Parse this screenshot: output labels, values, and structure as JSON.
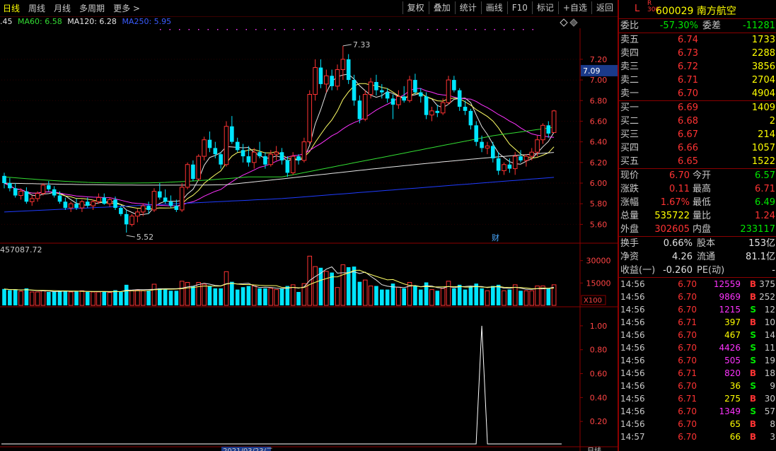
{
  "toolbar": {
    "periods": [
      "日线",
      "周线",
      "月线",
      "多周期",
      "更多 >"
    ],
    "actions": [
      "复权",
      "叠加",
      "统计",
      "画线",
      "F10",
      "标记",
      "+自选",
      "返回"
    ]
  },
  "legend": {
    "ma_partial": ".45",
    "ma60": "MA60: 6.58",
    "ma120": "MA120: 6.28",
    "ma250": "MA250: 5.95"
  },
  "price_axis": [
    "7.20",
    "7.00",
    "6.80",
    "6.60",
    "6.40",
    "6.20",
    "6.00",
    "5.80",
    "5.60"
  ],
  "price_tag": "7.09",
  "hi_label": "7.33",
  "lo_label": "5.52",
  "cai_label": "财",
  "vol_axis": [
    "30000",
    "15000"
  ],
  "vol_scale": "X100",
  "vol_value": "457087.72",
  "ind_axis": [
    "1.00",
    "0.80",
    "0.60",
    "0.40",
    "0.20"
  ],
  "bottom_date": "2021/03/23/二",
  "bottom_period": "日线",
  "colors": {
    "up": "#ff3333",
    "down": "#00e5ff",
    "ma_white": "#e6e6e6",
    "ma_yellow": "#ffff66",
    "ma_magenta": "#ff33ff",
    "ma_green": "#33dd33",
    "ma_blue": "#1f3cff"
  },
  "chart_data": {
    "type": "candlestick",
    "y_range": [
      5.5,
      7.35
    ],
    "candles": [
      [
        6.07,
        6.1,
        5.95,
        6.0
      ],
      [
        6.0,
        6.05,
        5.92,
        5.95
      ],
      [
        5.95,
        6.0,
        5.86,
        5.88
      ],
      [
        5.88,
        5.95,
        5.84,
        5.92
      ],
      [
        5.92,
        5.96,
        5.8,
        5.82
      ],
      [
        5.82,
        5.88,
        5.78,
        5.85
      ],
      [
        5.85,
        5.92,
        5.82,
        5.9
      ],
      [
        5.9,
        6.0,
        5.88,
        5.98
      ],
      [
        5.98,
        6.02,
        5.92,
        5.94
      ],
      [
        5.94,
        5.97,
        5.86,
        5.88
      ],
      [
        5.88,
        5.92,
        5.8,
        5.82
      ],
      [
        5.82,
        5.86,
        5.74,
        5.76
      ],
      [
        5.76,
        5.82,
        5.72,
        5.8
      ],
      [
        5.8,
        5.85,
        5.74,
        5.76
      ],
      [
        5.76,
        5.84,
        5.72,
        5.82
      ],
      [
        5.82,
        5.86,
        5.76,
        5.78
      ],
      [
        5.78,
        5.84,
        5.74,
        5.82
      ],
      [
        5.82,
        5.9,
        5.8,
        5.86
      ],
      [
        5.86,
        5.9,
        5.79,
        5.8
      ],
      [
        5.8,
        5.86,
        5.77,
        5.84
      ],
      [
        5.84,
        5.87,
        5.74,
        5.76
      ],
      [
        5.76,
        5.78,
        5.68,
        5.7
      ],
      [
        5.7,
        5.74,
        5.52,
        5.6
      ],
      [
        5.6,
        5.7,
        5.58,
        5.68
      ],
      [
        5.68,
        5.75,
        5.62,
        5.72
      ],
      [
        5.72,
        5.8,
        5.68,
        5.78
      ],
      [
        5.78,
        5.82,
        5.7,
        5.74
      ],
      [
        5.74,
        5.95,
        5.72,
        5.92
      ],
      [
        5.92,
        6.0,
        5.84,
        5.86
      ],
      [
        5.86,
        5.94,
        5.8,
        5.82
      ],
      [
        5.82,
        5.88,
        5.76,
        5.78
      ],
      [
        5.78,
        5.84,
        5.72,
        5.74
      ],
      [
        5.74,
        6.0,
        5.72,
        5.96
      ],
      [
        5.96,
        6.2,
        5.94,
        6.18
      ],
      [
        6.18,
        6.22,
        6.02,
        6.04
      ],
      [
        6.04,
        6.28,
        6.02,
        6.26
      ],
      [
        6.26,
        6.45,
        6.22,
        6.42
      ],
      [
        6.42,
        6.5,
        6.3,
        6.34
      ],
      [
        6.34,
        6.4,
        6.24,
        6.28
      ],
      [
        6.28,
        6.3,
        6.14,
        6.18
      ],
      [
        6.18,
        6.6,
        6.16,
        6.55
      ],
      [
        6.55,
        6.65,
        6.38,
        6.4
      ],
      [
        6.4,
        6.44,
        6.3,
        6.32
      ],
      [
        6.32,
        6.38,
        6.2,
        6.26
      ],
      [
        6.26,
        6.36,
        6.16,
        6.2
      ],
      [
        6.2,
        6.34,
        6.14,
        6.3
      ],
      [
        6.3,
        6.4,
        6.24,
        6.26
      ],
      [
        6.26,
        6.3,
        6.14,
        6.18
      ],
      [
        6.18,
        6.32,
        6.16,
        6.28
      ],
      [
        6.28,
        6.36,
        6.22,
        6.3
      ],
      [
        6.3,
        6.34,
        6.18,
        6.22
      ],
      [
        6.22,
        6.26,
        6.06,
        6.1
      ],
      [
        6.1,
        6.3,
        6.08,
        6.26
      ],
      [
        6.26,
        6.28,
        6.18,
        6.22
      ],
      [
        6.22,
        6.44,
        6.2,
        6.4
      ],
      [
        6.4,
        6.9,
        6.38,
        6.86
      ],
      [
        6.86,
        7.2,
        6.8,
        7.12
      ],
      [
        7.12,
        7.2,
        6.92,
        6.96
      ],
      [
        6.96,
        7.1,
        6.88,
        7.04
      ],
      [
        7.04,
        7.1,
        6.9,
        6.94
      ],
      [
        6.94,
        7.15,
        6.9,
        7.1
      ],
      [
        7.1,
        7.33,
        7.0,
        7.2
      ],
      [
        7.2,
        7.25,
        6.96,
        7.0
      ],
      [
        7.0,
        7.05,
        6.75,
        6.8
      ],
      [
        6.8,
        6.85,
        6.58,
        6.62
      ],
      [
        6.62,
        6.9,
        6.6,
        6.86
      ],
      [
        6.86,
        7.02,
        6.82,
        6.98
      ],
      [
        6.98,
        7.05,
        6.85,
        6.9
      ],
      [
        6.9,
        6.96,
        6.82,
        6.88
      ],
      [
        6.88,
        6.92,
        6.78,
        6.82
      ],
      [
        6.82,
        6.86,
        6.62,
        6.76
      ],
      [
        6.76,
        6.9,
        6.72,
        6.84
      ],
      [
        6.84,
        6.94,
        6.78,
        6.8
      ],
      [
        6.8,
        7.04,
        6.78,
        7.0
      ],
      [
        7.0,
        7.06,
        6.86,
        6.88
      ],
      [
        6.88,
        6.92,
        6.78,
        6.84
      ],
      [
        6.84,
        6.88,
        6.62,
        6.66
      ],
      [
        6.66,
        6.74,
        6.6,
        6.7
      ],
      [
        6.7,
        6.76,
        6.64,
        6.68
      ],
      [
        6.68,
        6.82,
        6.66,
        6.78
      ],
      [
        6.78,
        7.04,
        6.76,
        7.0
      ],
      [
        7.0,
        7.04,
        6.88,
        6.9
      ],
      [
        6.9,
        6.92,
        6.7,
        6.74
      ],
      [
        6.74,
        6.8,
        6.66,
        6.7
      ],
      [
        6.7,
        6.72,
        6.52,
        6.56
      ],
      [
        6.56,
        6.6,
        6.36,
        6.4
      ],
      [
        6.4,
        6.46,
        6.3,
        6.34
      ],
      [
        6.34,
        6.4,
        6.28,
        6.36
      ],
      [
        6.36,
        6.4,
        6.2,
        6.24
      ],
      [
        6.24,
        6.3,
        6.08,
        6.12
      ],
      [
        6.12,
        6.2,
        6.08,
        6.18
      ],
      [
        6.18,
        6.24,
        6.1,
        6.14
      ],
      [
        6.14,
        6.3,
        6.08,
        6.26
      ],
      [
        6.26,
        6.32,
        6.2,
        6.22
      ],
      [
        6.22,
        6.28,
        6.16,
        6.26
      ],
      [
        6.26,
        6.34,
        6.22,
        6.3
      ],
      [
        6.3,
        6.46,
        6.26,
        6.42
      ],
      [
        6.42,
        6.58,
        6.38,
        6.56
      ],
      [
        6.56,
        6.6,
        6.44,
        6.48
      ],
      [
        6.49,
        6.71,
        6.49,
        6.7
      ]
    ],
    "volume_max": 36000,
    "indicator": {
      "y_range": [
        0,
        1.1
      ],
      "spike_index": 86,
      "spike_value": 1.0
    }
  },
  "quote": {
    "L": "L",
    "R": "R",
    "idx": "300",
    "code_name": "600029 南方航空",
    "weibi_label": "委比",
    "weibi": "-57.30%",
    "weicha_label": "委差",
    "weicha": "-11281",
    "sells": [
      {
        "label": "卖五",
        "price": "6.74",
        "vol": "1733"
      },
      {
        "label": "卖四",
        "price": "6.73",
        "vol": "2288"
      },
      {
        "label": "卖三",
        "price": "6.72",
        "vol": "3856"
      },
      {
        "label": "卖二",
        "price": "6.71",
        "vol": "2704"
      },
      {
        "label": "卖一",
        "price": "6.70",
        "vol": "4904"
      }
    ],
    "buys": [
      {
        "label": "买一",
        "price": "6.69",
        "vol": "1409"
      },
      {
        "label": "买二",
        "price": "6.68",
        "vol": "2"
      },
      {
        "label": "买三",
        "price": "6.67",
        "vol": "214"
      },
      {
        "label": "买四",
        "price": "6.66",
        "vol": "1057"
      },
      {
        "label": "买五",
        "price": "6.65",
        "vol": "1522"
      }
    ],
    "stats": [
      {
        "l1": "现价",
        "v1": "6.70",
        "l2": "今开",
        "v2": "6.57"
      },
      {
        "l1": "涨跌",
        "v1": "0.11",
        "l2": "最高",
        "v2": "6.71"
      },
      {
        "l1": "涨幅",
        "v1": "1.67%",
        "l2": "最低",
        "v2": "6.49"
      },
      {
        "l1": "总量",
        "v1": "535722",
        "l2": "量比",
        "v2": "1.24"
      },
      {
        "l1": "外盘",
        "v1": "302605",
        "l2": "内盘",
        "v2": "233117"
      }
    ],
    "info": [
      {
        "l1": "换手",
        "v1": "0.66%",
        "l2": "股本",
        "v2": "153亿"
      },
      {
        "l1": "净资",
        "v1": "4.26",
        "l2": "流通",
        "v2": "81.1亿"
      },
      {
        "l1": "收益(一)",
        "v1": "-0.260",
        "l2": "PE(动)",
        "v2": "-"
      }
    ],
    "ticks": [
      {
        "t": "14:56",
        "p": "6.70",
        "q": "12559",
        "bs": "B",
        "n": "375"
      },
      {
        "t": "14:56",
        "p": "6.70",
        "q": "9869",
        "bs": "B",
        "n": "252"
      },
      {
        "t": "14:56",
        "p": "6.70",
        "q": "1215",
        "bs": "S",
        "n": "12"
      },
      {
        "t": "14:56",
        "p": "6.71",
        "q": "397",
        "bs": "B",
        "n": "10"
      },
      {
        "t": "14:56",
        "p": "6.70",
        "q": "467",
        "bs": "S",
        "n": "14"
      },
      {
        "t": "14:56",
        "p": "6.70",
        "q": "4426",
        "bs": "S",
        "n": "11"
      },
      {
        "t": "14:56",
        "p": "6.70",
        "q": "505",
        "bs": "S",
        "n": "19"
      },
      {
        "t": "14:56",
        "p": "6.71",
        "q": "820",
        "bs": "B",
        "n": "18"
      },
      {
        "t": "14:56",
        "p": "6.70",
        "q": "36",
        "bs": "S",
        "n": "9"
      },
      {
        "t": "14:56",
        "p": "6.71",
        "q": "275",
        "bs": "B",
        "n": "30"
      },
      {
        "t": "14:56",
        "p": "6.70",
        "q": "1349",
        "bs": "S",
        "n": "57"
      },
      {
        "t": "14:56",
        "p": "6.70",
        "q": "65",
        "bs": "B",
        "n": "8"
      },
      {
        "t": "14:57",
        "p": "6.70",
        "q": "66",
        "bs": "B",
        "n": "3"
      }
    ]
  }
}
